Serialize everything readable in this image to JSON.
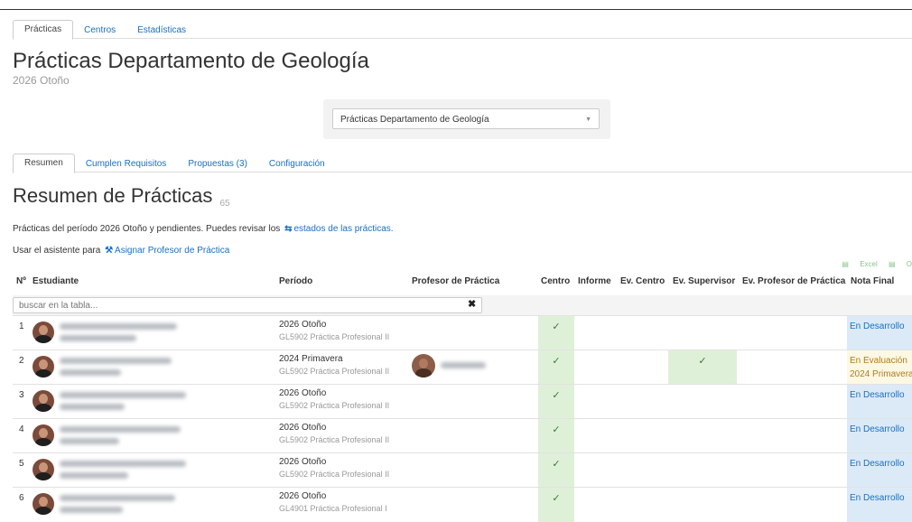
{
  "top_tabs": [
    "Prácticas",
    "Centros",
    "Estadísticas"
  ],
  "page": {
    "title": "Prácticas Departamento de Geología",
    "subtitle": "2026 Otoño"
  },
  "selector": {
    "value": "Prácticas Departamento de Geología"
  },
  "sub_tabs": [
    "Resumen",
    "Cumplen Requisitos",
    "Propuestas (3)",
    "Configuración"
  ],
  "section": {
    "title": "Resumen de Prácticas",
    "count": "65"
  },
  "description": {
    "line1_prefix": "Prácticas del período 2026 Otoño y pendientes. Puedes revisar los",
    "line1_link": "estados de las prácticas.",
    "line2_prefix": "Usar el asistente para",
    "line2_link": "Asignar Profesor de Práctica"
  },
  "exports": {
    "excel": "Excel",
    "other": "O"
  },
  "table": {
    "headers": [
      "Nº",
      "Estudiante",
      "Período",
      "Profesor de Práctica",
      "Centro",
      "Informe",
      "Ev. Centro",
      "Ev. Supervisor",
      "Ev. Profesor de Práctica",
      "Nota Final"
    ],
    "search_placeholder": "buscar en la tabla...",
    "check_mark": "✓",
    "rows": [
      {
        "num": "1",
        "period": "2026 Otoño",
        "course": "GL5902 Práctica Profesional II",
        "centro": true,
        "ev_supervisor": false,
        "has_profesor": false,
        "nota_lines": [
          "En Desarrollo"
        ],
        "nota_state": "dev"
      },
      {
        "num": "2",
        "period": "2024 Primavera",
        "course": "GL5902 Práctica Profesional II",
        "centro": true,
        "ev_supervisor": true,
        "has_profesor": true,
        "nota_lines": [
          "En Evaluación",
          "2024 Primavera"
        ],
        "nota_state": "eval"
      },
      {
        "num": "3",
        "period": "2026 Otoño",
        "course": "GL5902 Práctica Profesional II",
        "centro": true,
        "ev_supervisor": false,
        "has_profesor": false,
        "nota_lines": [
          "En Desarrollo"
        ],
        "nota_state": "dev"
      },
      {
        "num": "4",
        "period": "2026 Otoño",
        "course": "GL5902 Práctica Profesional II",
        "centro": true,
        "ev_supervisor": false,
        "has_profesor": false,
        "nota_lines": [
          "En Desarrollo"
        ],
        "nota_state": "dev"
      },
      {
        "num": "5",
        "period": "2026 Otoño",
        "course": "GL5902 Práctica Profesional II",
        "centro": true,
        "ev_supervisor": false,
        "has_profesor": false,
        "nota_lines": [
          "En Desarrollo"
        ],
        "nota_state": "dev"
      },
      {
        "num": "6",
        "period": "2026 Otoño",
        "course": "GL4901 Práctica Profesional I",
        "centro": true,
        "ev_supervisor": false,
        "has_profesor": false,
        "nota_lines": [
          "En Desarrollo"
        ],
        "nota_state": "dev"
      }
    ]
  },
  "colors": {
    "link": "#1a6fc1",
    "green_cell": "#dff0d8",
    "dev_cell": "#dbeaf6",
    "eval_cell": "#fcf8e3"
  }
}
